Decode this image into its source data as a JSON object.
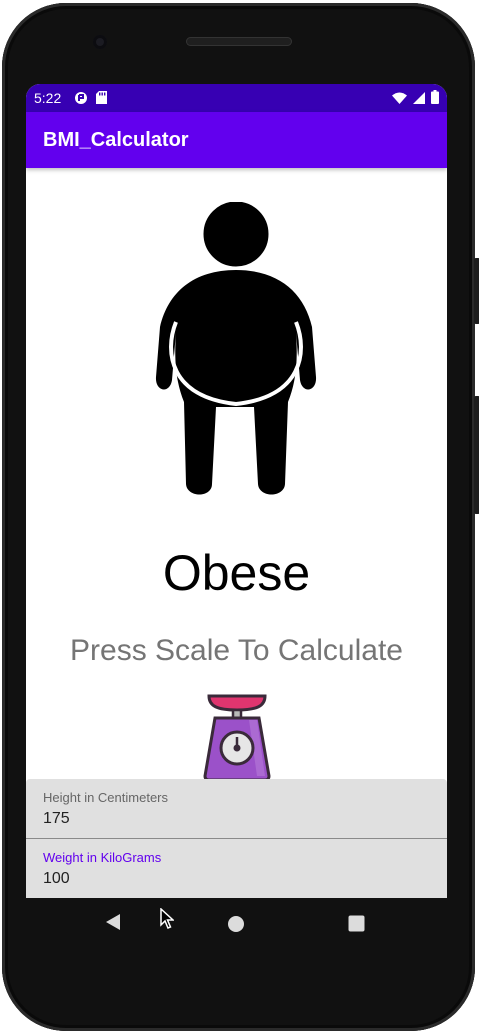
{
  "status_bar": {
    "time": "5:22",
    "left_icons": [
      "media-notification-icon",
      "sd-card-icon"
    ],
    "right_icons": [
      "wifi-icon",
      "signal-icon",
      "battery-icon"
    ]
  },
  "app_bar": {
    "title": "BMI_Calculator"
  },
  "result": {
    "figure_icon": "obese-person-icon",
    "category": "Obese",
    "instruction": "Press Scale To Calculate"
  },
  "scale_button": {
    "icon": "weighing-scale-icon"
  },
  "height_field": {
    "label": "Height in Centimeters",
    "value": "175"
  },
  "weight_field": {
    "label": "Weight in KiloGrams",
    "value": "100"
  },
  "navigation": {
    "buttons": [
      "back-icon",
      "home-icon",
      "recents-icon"
    ]
  },
  "colors": {
    "primary": "#6200ee",
    "primary_dark": "#3700b3",
    "scale_pink": "#e0356f",
    "scale_purple": "#9b51c9"
  }
}
